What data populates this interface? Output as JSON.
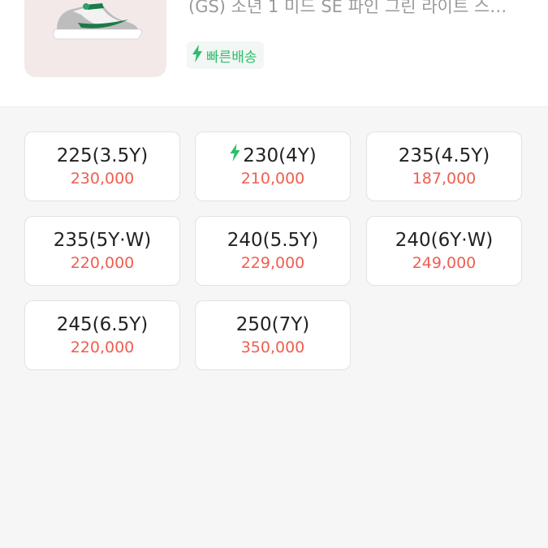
{
  "product": {
    "title": "(GS) 소년 1 미드 SE 파인 그린 라이트 스…",
    "badge_label": "빠른배송",
    "image_alt": "sneaker-thumbnail"
  },
  "colors": {
    "accent_green": "#2cbd6c",
    "price_red": "#ef5e50",
    "card_border": "#e2e2e2",
    "background": "#f6f6f6"
  },
  "sizes": [
    {
      "label": "225(3.5Y)",
      "price": "230,000",
      "fast": false
    },
    {
      "label": "230(4Y)",
      "price": "210,000",
      "fast": true
    },
    {
      "label": "235(4.5Y)",
      "price": "187,000",
      "fast": false
    },
    {
      "label": "235(5Y·W)",
      "price": "220,000",
      "fast": false
    },
    {
      "label": "240(5.5Y)",
      "price": "229,000",
      "fast": false
    },
    {
      "label": "240(6Y·W)",
      "price": "249,000",
      "fast": false
    },
    {
      "label": "245(6.5Y)",
      "price": "220,000",
      "fast": false
    },
    {
      "label": "250(7Y)",
      "price": "350,000",
      "fast": false
    }
  ]
}
